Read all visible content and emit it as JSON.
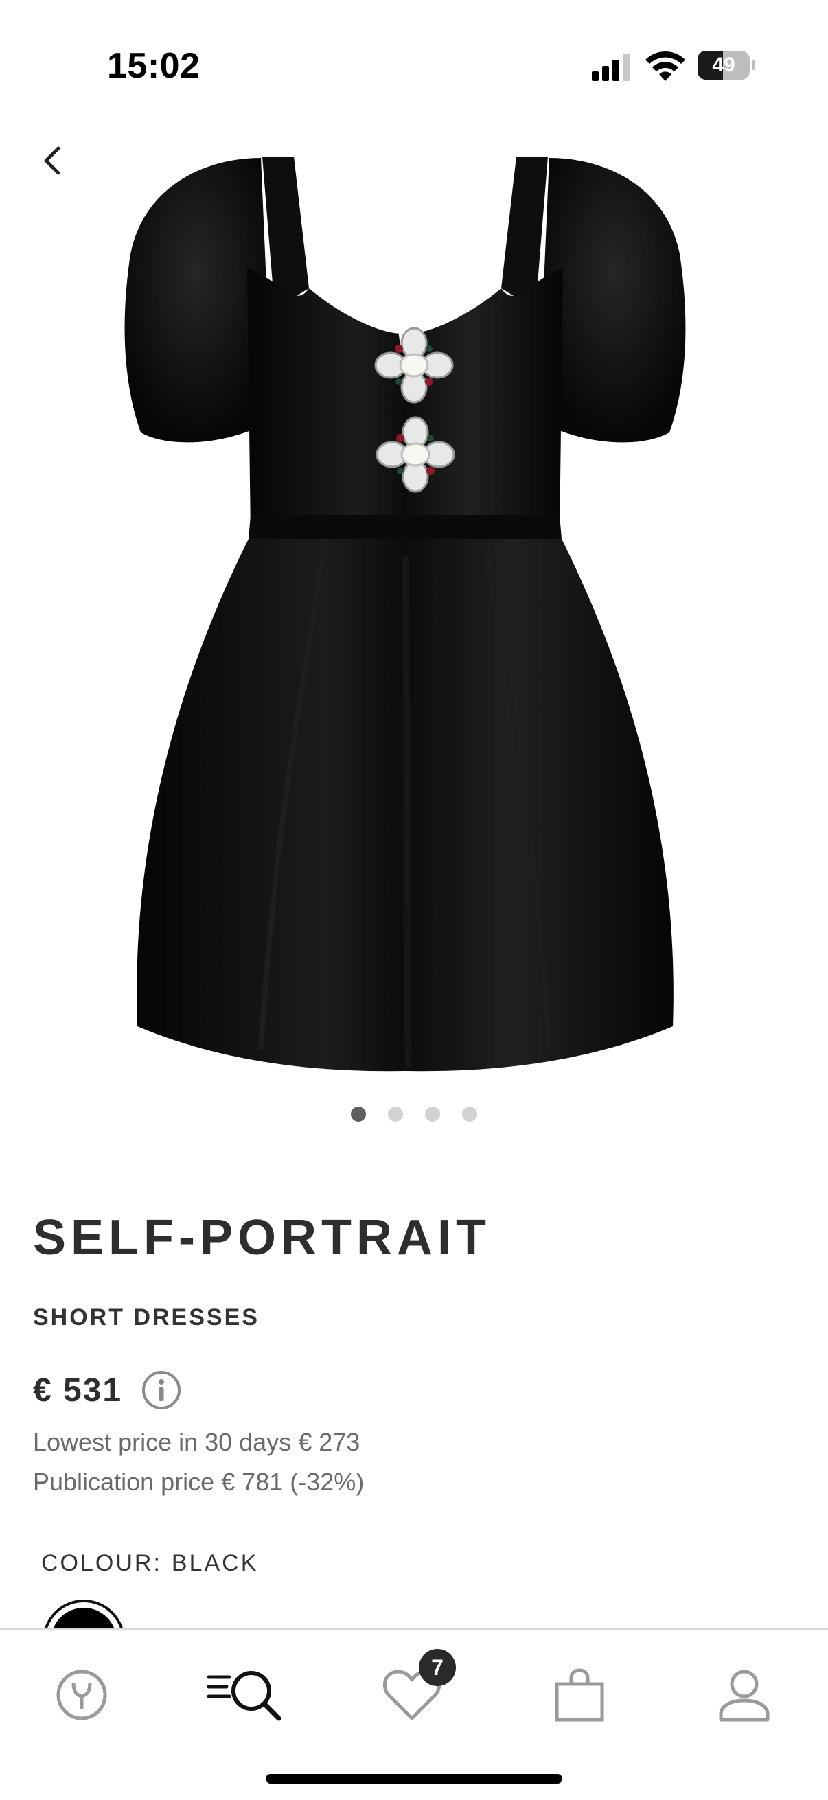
{
  "status_bar": {
    "time": "15:02",
    "battery_level": "49",
    "icons": [
      "cellular-signal-icon",
      "wifi-icon",
      "battery-icon"
    ]
  },
  "navigation": {
    "back_icon": "chevron-left-icon"
  },
  "product": {
    "image": "black-velvet-puff-sleeve-mini-dress-with-crystal-brooches",
    "carousel": {
      "total": 4,
      "active_index": 0
    },
    "brand": "SELF-PORTRAIT",
    "category": "SHORT DRESSES",
    "price": "€ 531",
    "info_icon": "info-icon",
    "lowest_price": "Lowest price in 30 days € 273",
    "publication_price": "Publication price € 781 (-32%)",
    "colour_label": "COLOUR:",
    "colour_value": "BLACK",
    "colour_swatch": "#000000"
  },
  "bottom_nav": {
    "items": [
      {
        "name": "home",
        "icon": "yoox-logo-icon"
      },
      {
        "name": "search",
        "icon": "menu-search-icon",
        "active": true
      },
      {
        "name": "wishlist",
        "icon": "heart-icon",
        "badge": "7"
      },
      {
        "name": "bag",
        "icon": "shopping-bag-icon"
      },
      {
        "name": "account",
        "icon": "user-icon"
      }
    ]
  },
  "colors": {
    "text_primary": "#2e2e2e",
    "text_secondary": "#6a6a6a",
    "dot_active": "#5f5f5f",
    "dot_inactive": "#d2d2d2",
    "badge": "#2a2a2a"
  }
}
